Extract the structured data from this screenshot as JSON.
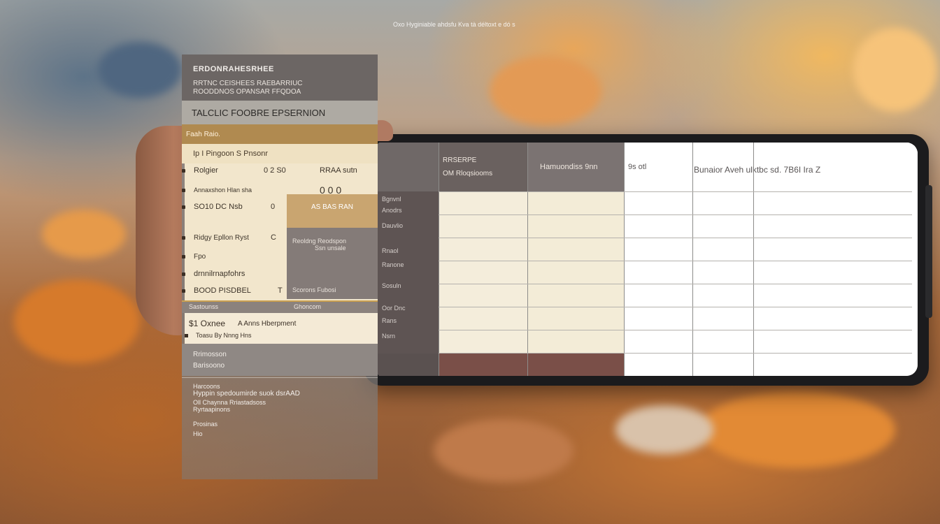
{
  "caption": "Oxo  Hyginiable ahdsfu Kva  tà déltoxt e dó s",
  "panel": {
    "header_title": "ERDONRAHESRHEE",
    "header_sub1": "RRTNC CEISHEES RAEBARRIUC",
    "header_sub2": "ROODDNOS OPANSAR FFQDOA",
    "section_title": "TALCLIC FOOBRE EPSERNION",
    "gold_label": "Faah Raio.",
    "cream_label": "Ip I Pingoon S  Pnsonr",
    "rows": [
      {
        "a": "Rolgier",
        "b": "0 2 S0",
        "c": "RRAA sutn"
      },
      {
        "a": "Annaxshon Hlan sha",
        "b": "",
        "c": "0 0 0"
      },
      {
        "a": "SO10 DC Nsb",
        "b": "0",
        "c": "AS BAS RAN"
      },
      {
        "a": "Ridgy Epllon  Ryst",
        "b": "C",
        "c": ""
      },
      {
        "a": "Fpo",
        "b": "",
        "c": ""
      },
      {
        "a": "drnnilrnapfohrs",
        "b": "",
        "c": ""
      },
      {
        "a": "BOOD PISDBEL",
        "b": "T",
        "c": ""
      }
    ],
    "right_notes": [
      "Reoldng Reodspon",
      "Ssn unsale",
      "Scorons Fubosi"
    ],
    "strip_left": "Sastounss",
    "strip_right": "Ghoncom",
    "light_row_1_a": "$1 Oxnee",
    "light_row_1_b": "A  Anns Hberpment",
    "light_row_2": "Toasu By Nnng Hns",
    "grey_1": "Rrimosson",
    "grey_2": "Barisoono",
    "bottom_lines": [
      "Harcoons",
      "Hyppin spedoumirde suok dsrAAD",
      "Oll Chaynna Rriastadsoss",
      "Ryrtaapinons",
      "Prosinas",
      "Hio"
    ]
  },
  "table": {
    "c1_head_1": "RRSERPE",
    "c1_head_2": "OM Rloqsiooms",
    "c2_head": "Hamuondiss 9nn",
    "c3_head": "9s otl",
    "c4_c5_head": "Bunaior Aveh ulktbc sd.    7B6I Ira Z",
    "c0_labels": [
      "Bgnvnl",
      "Anodrs",
      "Dauvlio",
      "Rnaol",
      "Ranone",
      "Sosuln",
      "Oor Dnc",
      "Rans",
      "Nsrn"
    ],
    "row_count": 8
  }
}
